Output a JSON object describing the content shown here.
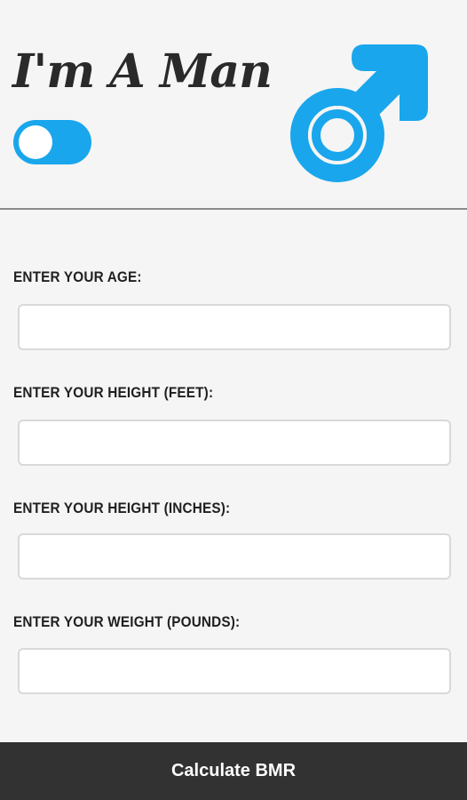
{
  "header": {
    "title": "I'm A Man",
    "toggle": {
      "state": "off",
      "color": "#19a6ec"
    },
    "gender_icon": {
      "name": "male-symbol-icon",
      "color": "#19a6ec"
    }
  },
  "form": {
    "fields": [
      {
        "label": "ENTER YOUR AGE:",
        "value": "",
        "placeholder": ""
      },
      {
        "label": "ENTER YOUR HEIGHT (FEET):",
        "value": "",
        "placeholder": ""
      },
      {
        "label": "ENTER YOUR HEIGHT (INCHES):",
        "value": "",
        "placeholder": ""
      },
      {
        "label": "ENTER YOUR WEIGHT (POUNDS):",
        "value": "",
        "placeholder": ""
      }
    ]
  },
  "footer": {
    "button_label": "Calculate BMR"
  }
}
